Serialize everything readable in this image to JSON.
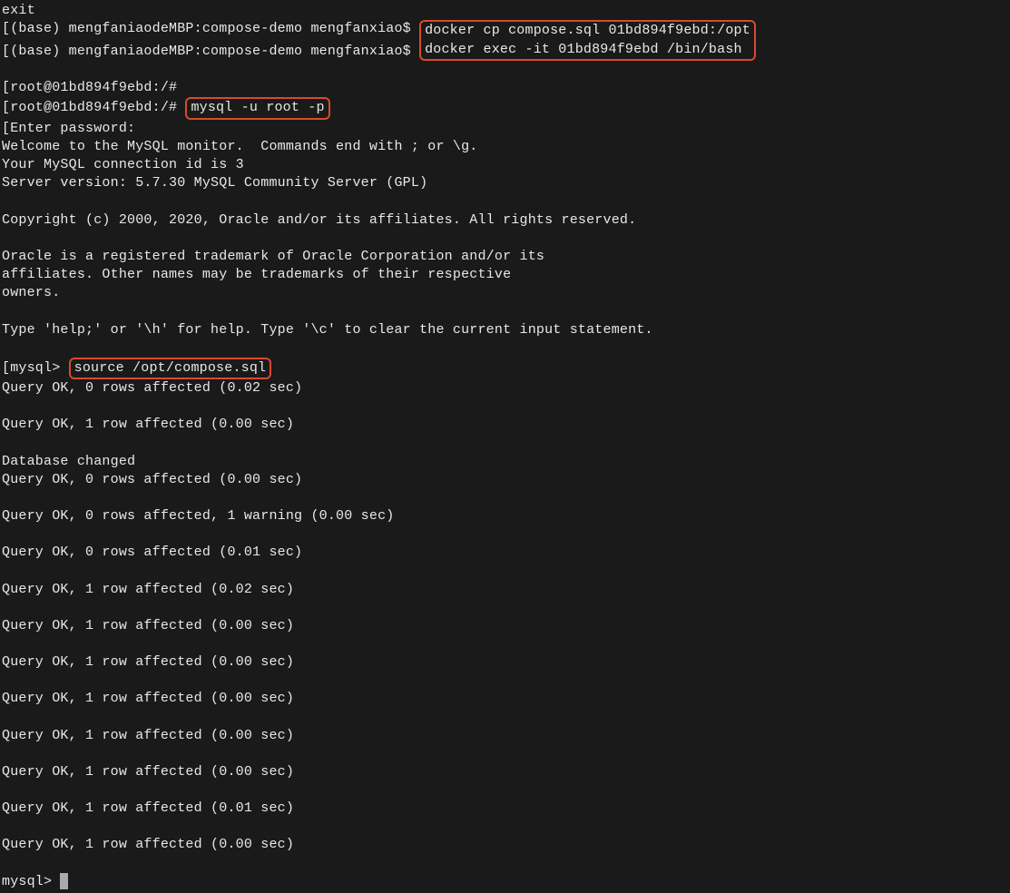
{
  "lines": {
    "exit_top": "exit",
    "prompt1_prefix": "[(base) mengfaniaodeMBP:compose-demo mengfanxiao$ ",
    "cmd1": "docker cp compose.sql 01bd894f9ebd:/opt",
    "prompt2_prefix": "[(base) mengfaniaodeMBP:compose-demo mengfanxiao$ ",
    "cmd2": "docker exec -it 01bd894f9ebd /bin/bash",
    "root1": "[root@01bd894f9ebd:/#",
    "root2_prefix": "[root@01bd894f9ebd:/# ",
    "mysql_login": "mysql -u root -p",
    "enter_pw": "[Enter password:",
    "welcome": "Welcome to the MySQL monitor.  Commands end with ; or \\g.",
    "conn_id": "Your MySQL connection id is 3",
    "server_ver": "Server version: 5.7.30 MySQL Community Server (GPL)",
    "copyright": "Copyright (c) 2000, 2020, Oracle and/or its affiliates. All rights reserved.",
    "oracle1": "Oracle is a registered trademark of Oracle Corporation and/or its",
    "oracle2": "affiliates. Other names may be trademarks of their respective",
    "oracle3": "owners.",
    "help_line": "Type 'help;' or '\\h' for help. Type '\\c' to clear the current input statement.",
    "mysql_prompt1_prefix": "[mysql> ",
    "source_cmd": "source /opt/compose.sql",
    "q1": "Query OK, 0 rows affected (0.02 sec)",
    "q2": "Query OK, 1 row affected (0.00 sec)",
    "db_changed": "Database changed",
    "q3": "Query OK, 0 rows affected (0.00 sec)",
    "q4": "Query OK, 0 rows affected, 1 warning (0.00 sec)",
    "q5": "Query OK, 0 rows affected (0.01 sec)",
    "q6": "Query OK, 1 row affected (0.02 sec)",
    "q7": "Query OK, 1 row affected (0.00 sec)",
    "q8": "Query OK, 1 row affected (0.00 sec)",
    "q9": "Query OK, 1 row affected (0.00 sec)",
    "q10": "Query OK, 1 row affected (0.00 sec)",
    "q11": "Query OK, 1 row affected (0.00 sec)",
    "q12": "Query OK, 1 row affected (0.01 sec)",
    "q13": "Query OK, 1 row affected (0.00 sec)",
    "mysql_prompt2": "mysql> "
  }
}
